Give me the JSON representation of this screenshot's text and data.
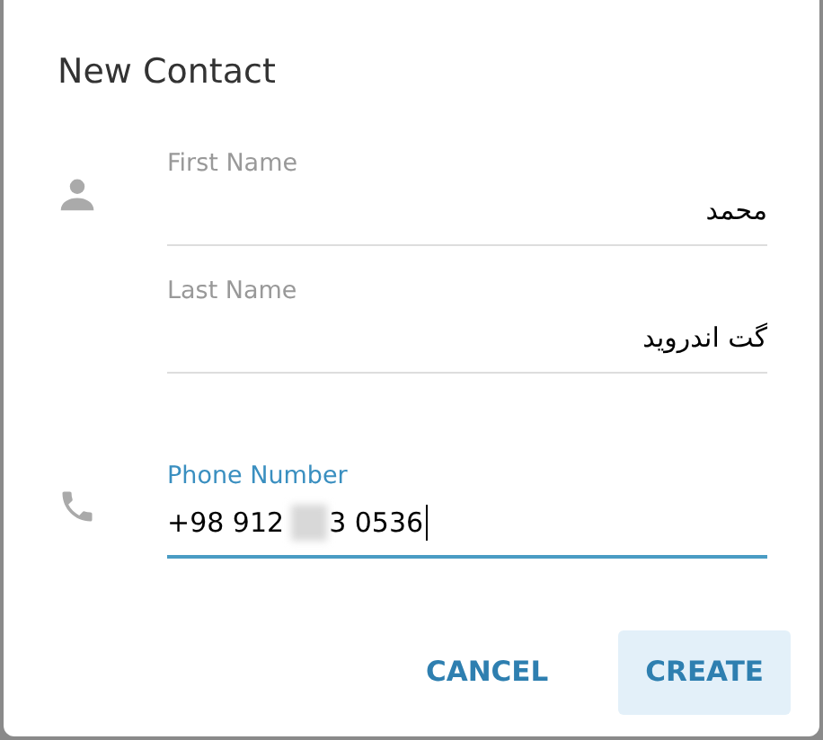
{
  "dialog": {
    "title": "New Contact"
  },
  "fields": [
    {
      "kind": "name",
      "label": "First Name",
      "value": "محمد",
      "rtl": true,
      "focused": false
    },
    {
      "kind": "name",
      "label": "Last Name",
      "value": "گت اندروید",
      "rtl": true,
      "focused": false
    },
    {
      "kind": "phone",
      "label": "Phone Number",
      "value_start": "+98 912",
      "value_end": "3 0536",
      "redacted": true,
      "rtl": false,
      "focused": true
    }
  ],
  "buttons": [
    {
      "label": "CANCEL",
      "highlighted": false
    },
    {
      "label": "CREATE",
      "highlighted": true
    }
  ]
}
